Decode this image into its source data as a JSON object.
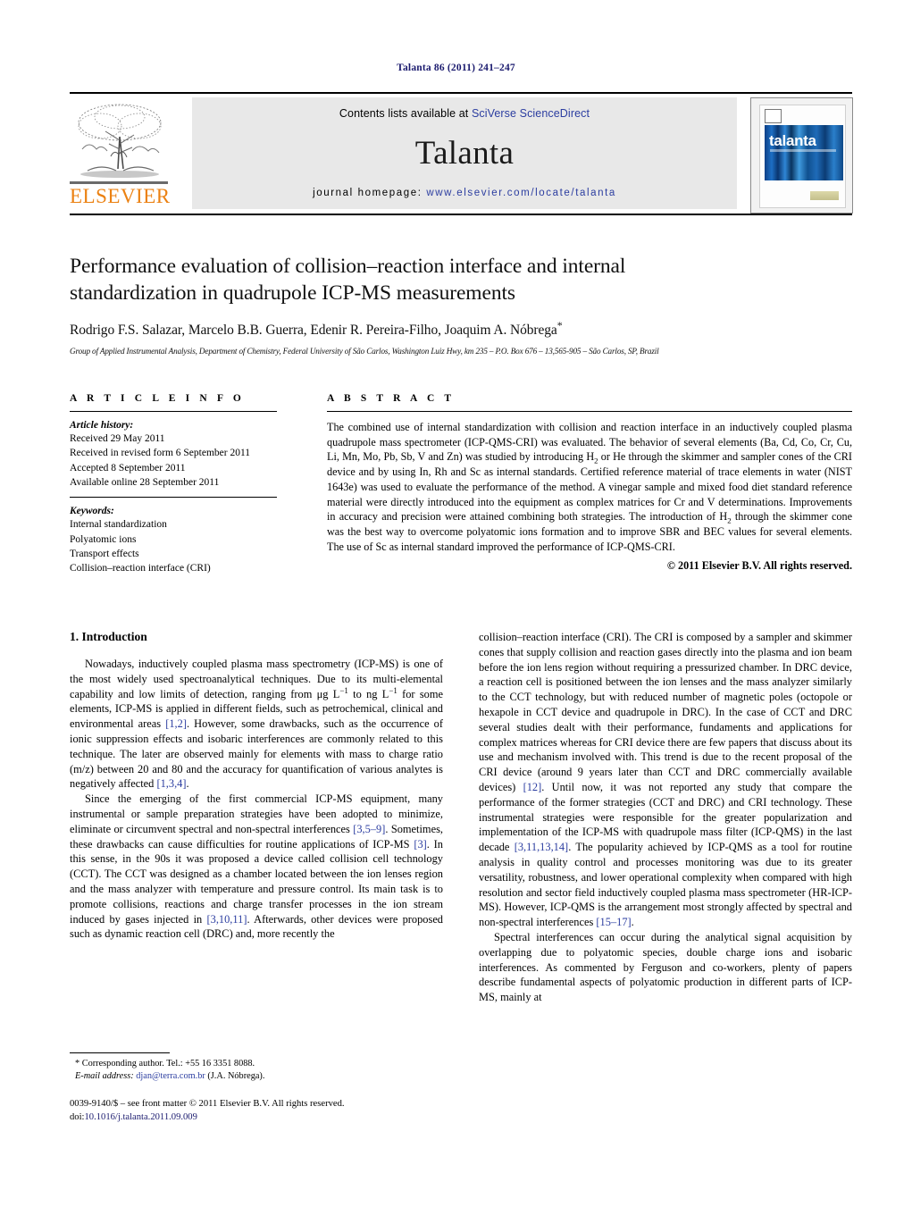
{
  "running_head": "Talanta 86 (2011) 241–247",
  "masthead": {
    "publisher_wordmark": "ELSEVIER",
    "contents_prefix": "Contents lists available at ",
    "contents_link": "SciVerse ScienceDirect",
    "journal_name": "Talanta",
    "homepage_prefix": "journal homepage: ",
    "homepage_link": "www.elsevier.com/locate/talanta",
    "cover_title": "talanta",
    "link_color": "#2b3da0",
    "elsevier_orange": "#eb8112"
  },
  "article": {
    "title_line1": "Performance evaluation of collision–reaction interface and internal",
    "title_line2": "standardization in quadrupole ICP-MS measurements",
    "authors": "Rodrigo F.S. Salazar, Marcelo B.B. Guerra, Edenir R. Pereira-Filho, Joaquim A. Nóbrega",
    "author_marker": "*",
    "affiliation": "Group of Applied Instrumental Analysis, Department of Chemistry, Federal University of São Carlos, Washington Luiz Hwy, km 235 – P.O. Box 676 – 13,565-905 – São Carlos, SP, Brazil"
  },
  "article_info": {
    "heading": "A R T I C L E   I N F O",
    "history_label": "Article history:",
    "history": [
      "Received 29 May 2011",
      "Received in revised form 6 September 2011",
      "Accepted 8 September 2011",
      "Available online 28 September 2011"
    ],
    "keywords_label": "Keywords:",
    "keywords": [
      "Internal standardization",
      "Polyatomic ions",
      "Transport effects",
      "Collision–reaction interface (CRI)"
    ]
  },
  "abstract": {
    "heading": "A B S T R A C T",
    "part1": "The combined use of internal standardization with collision and reaction interface in an inductively coupled plasma quadrupole mass spectrometer (ICP-QMS-CRI) was evaluated. The behavior of several elements (Ba, Cd, Co, Cr, Cu, Li, Mn, Mo, Pb, Sb, V and Zn) was studied by introducing H",
    "sub1": "2",
    "part2": " or He through the skimmer and sampler cones of the CRI device and by using In, Rh and Sc as internal standards. Certified reference material of trace elements in water (NIST 1643e) was used to evaluate the performance of the method. A vinegar sample and mixed food diet standard reference material were directly introduced into the equipment as complex matrices for Cr and V determinations. Improvements in accuracy and precision were attained combining both strategies. The introduction of H",
    "sub2": "2",
    "part3": " through the skimmer cone was the best way to overcome polyatomic ions formation and to improve SBR and BEC values for several elements. The use of Sc as internal standard improved the performance of ICP-QMS-CRI.",
    "copyright": "© 2011 Elsevier B.V. All rights reserved."
  },
  "introduction": {
    "heading": "1.  Introduction",
    "left_p1_a": "Nowadays, inductively coupled plasma mass spectrometry (ICP-MS) is one of the most widely used spectroanalytical techniques. Due to its multi-elemental capability and low limits of detection, ranging from μg L",
    "left_p1_sup1": "−1",
    "left_p1_b": " to ng L",
    "left_p1_sup2": "−1",
    "left_p1_c": " for some elements, ICP-MS is applied in different fields, such as petrochemical, clinical and environmental areas ",
    "left_p1_ref1": "[1,2]",
    "left_p1_d": ". However, some drawbacks, such as the occurrence of ionic suppression effects and isobaric interferences are commonly related to this technique. The later are observed mainly for elements with mass to charge ratio (m/z) between 20 and 80 and the accuracy for quantification of various analytes is negatively affected ",
    "left_p1_ref2": "[1,3,4]",
    "left_p1_e": ".",
    "left_p2_a": "Since the emerging of the first commercial ICP-MS equipment, many instrumental or sample preparation strategies have been adopted to minimize, eliminate or circumvent spectral and non-spectral interferences ",
    "left_p2_ref1": "[3,5–9]",
    "left_p2_b": ". Sometimes, these drawbacks can cause difficulties for routine applications of ICP-MS ",
    "left_p2_ref2": "[3]",
    "left_p2_c": ". In this sense, in the 90s it was proposed a device called collision cell technology (CCT). The CCT was designed as a chamber located between the ion lenses region and the mass analyzer with temperature and pressure control. Its main task is to promote collisions, reactions and charge transfer processes in the ion stream induced by gases injected in ",
    "left_p2_ref3": "[3,10,11]",
    "left_p2_d": ". Afterwards, other devices were proposed such as dynamic reaction cell (DRC) and, more recently the",
    "right_p1_a": "collision–reaction interface (CRI). The CRI is composed by a sampler and skimmer cones that supply collision and reaction gases directly into the plasma and ion beam before the ion lens region without requiring a pressurized chamber. In DRC device, a reaction cell is positioned between the ion lenses and the mass analyzer similarly to the CCT technology, but with reduced number of magnetic poles (octopole or hexapole in CCT device and quadrupole in DRC). In the case of CCT and DRC several studies dealt with their performance, fundaments and applications for complex matrices whereas for CRI device there are few papers that discuss about its use and mechanism involved with. This trend is due to the recent proposal of the CRI device (around 9 years later than CCT and DRC commercially available devices) ",
    "right_p1_ref1": "[12]",
    "right_p1_b": ". Until now, it was not reported any study that compare the performance of the former strategies (CCT and DRC) and CRI technology. These instrumental strategies were responsible for the greater popularization and implementation of the ICP-MS with quadrupole mass filter (ICP-QMS) in the last decade ",
    "right_p1_ref2": "[3,11,13,14]",
    "right_p1_c": ". The popularity achieved by ICP-QMS as a tool for routine analysis in quality control and processes monitoring was due to its greater versatility, robustness, and lower operational complexity when compared with high resolution and sector field inductively coupled plasma mass spectrometer (HR-ICP-MS). However, ICP-QMS is the arrangement most strongly affected by spectral and non-spectral interferences ",
    "right_p1_ref3": "[15–17]",
    "right_p1_d": ".",
    "right_p2": "Spectral interferences can occur during the analytical signal acquisition by overlapping due to polyatomic species, double charge ions and isobaric interferences. As commented by Ferguson and co-workers, plenty of papers describe fundamental aspects of polyatomic production in different parts of ICP-MS, mainly at"
  },
  "footnote": {
    "marker": "*",
    "corresponding": " Corresponding author. Tel.: +55 16 3351 8088.",
    "email_label": "E-mail address:",
    "email": "djan@terra.com.br",
    "email_suffix": " (J.A. Nóbrega)."
  },
  "footer": {
    "front_matter": "0039-9140/$ – see front matter © 2011 Elsevier B.V. All rights reserved.",
    "doi_label": "doi:",
    "doi": "10.1016/j.talanta.2011.09.009"
  }
}
